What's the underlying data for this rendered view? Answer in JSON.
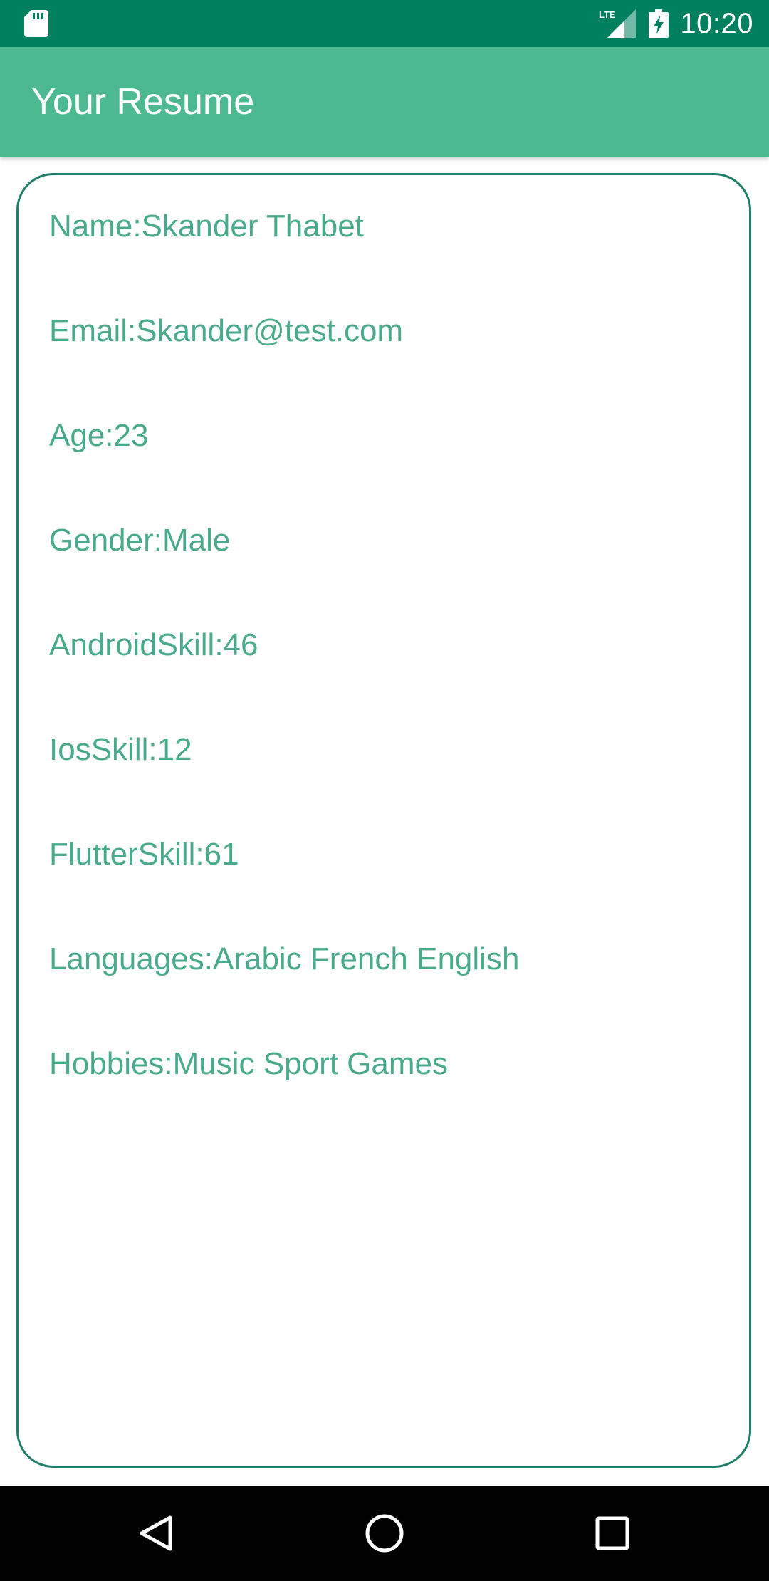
{
  "status_bar": {
    "time": "10:20",
    "network": "LTE",
    "icons": [
      "sd-card-icon",
      "signal-icon",
      "battery-charging-icon"
    ]
  },
  "app_bar": {
    "title": "Your Resume"
  },
  "resume": {
    "fields": [
      "Name:Skander Thabet",
      "Email:Skander@test.com",
      "Age:23",
      "Gender:Male",
      "AndroidSkill:46",
      "IosSkill:12",
      "FlutterSkill:61",
      "Languages:Arabic French English",
      "Hobbies:Music Sport Games"
    ]
  },
  "navigation_bar": {
    "icons": [
      "back-icon",
      "home-icon",
      "recents-icon"
    ]
  },
  "colors": {
    "status_bar": "#00805f",
    "app_bar": "#4db990",
    "card_border": "#1e7e6a",
    "field_text": "#4aab8c"
  }
}
